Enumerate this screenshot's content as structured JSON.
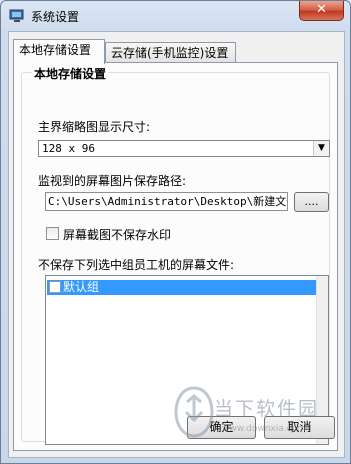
{
  "window": {
    "title": "系统设置",
    "close_glyph": "✕"
  },
  "tabs": [
    {
      "label": "本地存储设置"
    },
    {
      "label": "云存储(手机监控)设置"
    }
  ],
  "group": {
    "title": "本地存储设置",
    "thumbnail_label": "主界缩略图显示尺寸:",
    "thumbnail_value": "128 x 96",
    "path_label": "监视到的屏幕图片保存路径:",
    "path_value": "C:\\Users\\Administrator\\Desktop\\新建文件",
    "browse_label": "....",
    "watermark_checkbox_label": "屏幕截图不保存水印",
    "watermark_checked": false,
    "list_label": "不保存下列选中组员工机的屏幕文件:",
    "list_items": [
      {
        "label": "默认组",
        "checked": false
      }
    ]
  },
  "buttons": {
    "ok": "确定",
    "cancel": "取消"
  },
  "overlay_watermark": {
    "text": "当下软件园",
    "url": "www.downxia.com"
  },
  "colors": {
    "selection": "#3399ff",
    "close_button": "#c4391f"
  },
  "icons": {
    "app": "monitor-icon",
    "dropdown": "chevron-down-icon"
  }
}
